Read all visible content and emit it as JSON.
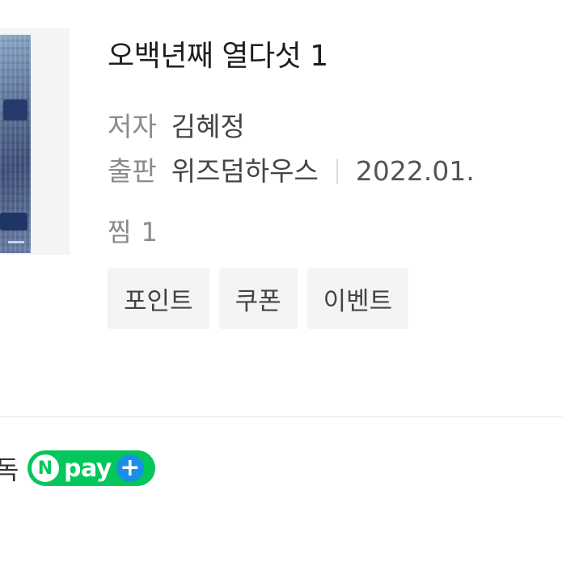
{
  "book": {
    "title": "오백년째 열다섯 1",
    "author_label": "저자",
    "author": "김혜정",
    "publisher_label": "출판",
    "publisher": "위즈덤하우스",
    "date": "2022.01."
  },
  "likes": {
    "label": "찜",
    "count": "1"
  },
  "tags": [
    "포인트",
    "쿠폰",
    "이벤트"
  ],
  "footer": {
    "partial_text": "독",
    "npay": {
      "n_letter": "N",
      "text": "pay",
      "plus": "+"
    }
  },
  "colors": {
    "npay_green": "#03c75a",
    "npay_plus_blue": "#1a8fe6",
    "tag_bg": "#f2f4f6"
  }
}
